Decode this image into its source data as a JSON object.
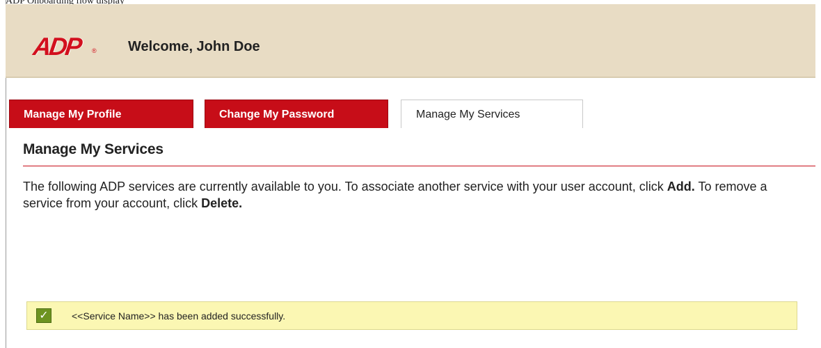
{
  "header": {
    "top_caption": "ADP Onboarding flow display",
    "logo_text": "ADP",
    "logo_mark": "®",
    "welcome": "Welcome, John Doe"
  },
  "tabs": [
    {
      "label": "Manage My Profile",
      "active": false
    },
    {
      "label": "Change My Password",
      "active": false
    },
    {
      "label": "Manage My Services",
      "active": true
    }
  ],
  "section": {
    "title": "Manage My Services",
    "intro_part1": "The following ADP services are currently available to you. To associate another service with your user account, click ",
    "add_word": "Add.",
    "intro_part2": " To remove a service from your account, click ",
    "delete_word": "Delete."
  },
  "success_message": {
    "icon": "checkmark-icon",
    "text": "<<Service Name>> has been added successfully."
  },
  "colors": {
    "brand_red": "#c70d18",
    "header_bg": "#e8dcc4",
    "success_bg": "#fbf7b3",
    "check_green": "#6d9320"
  }
}
